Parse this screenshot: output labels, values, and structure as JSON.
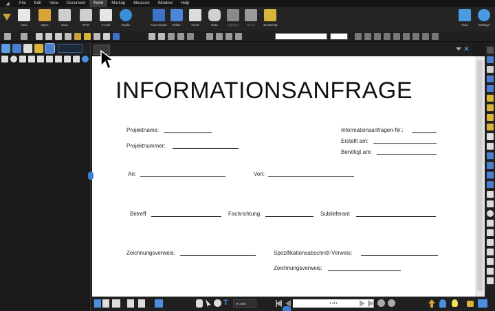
{
  "menu": {
    "items": [
      "File",
      "Edit",
      "View",
      "Document",
      "Form",
      "Markup",
      "Measure",
      "Window",
      "Help"
    ],
    "active": "Form"
  },
  "ribbon": {
    "buttons": [
      {
        "label": "New",
        "color": "#e8e8e8"
      },
      {
        "label": "Open",
        "color": "#d9a43a"
      },
      {
        "label": "Save",
        "color": "#cfcfcf"
      },
      {
        "label": "Print",
        "color": "#cfcfcf"
      },
      {
        "label": "E-mail",
        "color": "#e6e6e6"
      },
      {
        "label": "Studio",
        "color": "#3b8fd9"
      },
      {
        "label": "Auto Create",
        "color": "#3e74c8"
      },
      {
        "label": "Editor",
        "color": "#4c86d6"
      },
      {
        "label": "Insert",
        "color": "#dcdcdc"
      },
      {
        "label": "Data",
        "color": "#d0d0d0"
      },
      {
        "label": "Highlight",
        "color": "#8a8a8a"
      },
      {
        "label": "Reset",
        "color": "#9a9a9a"
      },
      {
        "label": "JavaScript",
        "color": "#d9b43a"
      },
      {
        "label": "View",
        "color": "#4a9ae0"
      },
      {
        "label": "Settings",
        "color": "#4a9ae0"
      }
    ]
  },
  "form": {
    "title": "INFORMATIONSANFRAGE",
    "fields": {
      "projektname": "Projektname:",
      "projektnummer": "Projektnummer:",
      "info_nr": "Informationsanfragen-Nr.:",
      "erstellt": "Erstellt am:",
      "benoetigt": "Benötigt am:",
      "an": "An:",
      "von": "Von:",
      "betreff": "Betreff",
      "fachrichtung": "Fachrichtung",
      "sublieferant": "Sublieferant",
      "zeichnungsverweis1": "Zeichnungsverweis:",
      "spezifikation": "Spezifikationsabschnitt-Verweis:",
      "zeichnungsverweis2": "Zeichnungsverweis:"
    }
  },
  "status": {
    "zoom": "97.05%",
    "page": "1 of 1"
  }
}
